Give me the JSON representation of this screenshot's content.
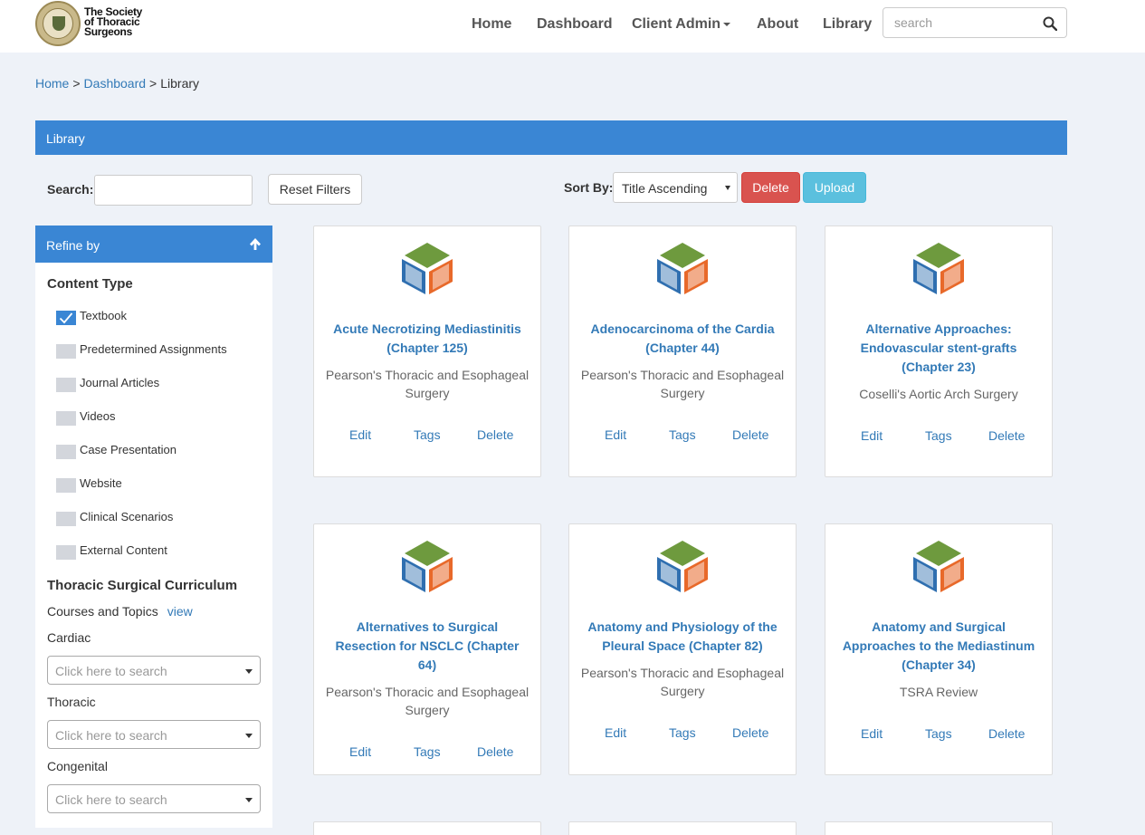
{
  "brand": {
    "name_line1": "The Society",
    "name_line2": "of Thoracic",
    "name_line3": "Surgeons"
  },
  "nav": {
    "home": "Home",
    "dashboard": "Dashboard",
    "client_admin": "Client Admin",
    "about": "About",
    "library": "Library",
    "search_placeholder": "search"
  },
  "breadcrumb": {
    "home": "Home",
    "dashboard": "Dashboard",
    "current": "Library",
    "separator": ">"
  },
  "library_bar": {
    "title": "Library"
  },
  "controls": {
    "search_label": "Search:",
    "reset_label": "Reset Filters",
    "sort_label": "Sort By:",
    "sort_value": "Title Ascending",
    "delete_label": "Delete",
    "upload_label": "Upload"
  },
  "sidebar": {
    "refine_title": "Refine by",
    "content_type_heading": "Content Type",
    "content_types": [
      {
        "label": "Textbook",
        "checked": true
      },
      {
        "label": "Predetermined Assignments",
        "checked": false
      },
      {
        "label": "Journal Articles",
        "checked": false
      },
      {
        "label": "Videos",
        "checked": false
      },
      {
        "label": "Case Presentation",
        "checked": false
      },
      {
        "label": "Website",
        "checked": false
      },
      {
        "label": "Clinical Scenarios",
        "checked": false
      },
      {
        "label": "External Content",
        "checked": false
      }
    ],
    "curriculum_heading": "Thoracic Surgical Curriculum",
    "courses_label": "Courses and Topics",
    "view_label": "view",
    "cardiac_label": "Cardiac",
    "thoracic_label": "Thoracic",
    "congenital_label": "Congenital",
    "select_placeholder": "Click here to search"
  },
  "cards": [
    {
      "title": "Acute Necrotizing Mediastinitis (Chapter 125)",
      "source": "Pearson's Thoracic and Esophageal Surgery"
    },
    {
      "title": "Adenocarcinoma of the Cardia (Chapter 44)",
      "source": "Pearson's Thoracic and Esophageal Surgery"
    },
    {
      "title": "Alternative Approaches: Endovascular stent-grafts (Chapter 23)",
      "source": "Coselli's Aortic Arch Surgery"
    },
    {
      "title": "Alternatives to Surgical Resection for NSCLC (Chapter 64)",
      "source": "Pearson's Thoracic and Esophageal Surgery"
    },
    {
      "title": "Anatomy and Physiology of the Pleural Space (Chapter 82)",
      "source": "Pearson's Thoracic and Esophageal Surgery"
    },
    {
      "title": "Anatomy and Surgical Approaches to the Mediastinum (Chapter 34)",
      "source": "TSRA Review"
    }
  ],
  "card_actions": {
    "edit": "Edit",
    "tags": "Tags",
    "delete": "Delete"
  },
  "colors": {
    "primary": "#3a86d4",
    "danger": "#d9534f",
    "info": "#5bc0de",
    "link": "#337ab7",
    "book_green": "#6e9a3e",
    "book_blue": "#2f6fb0",
    "book_orange": "#e8692a"
  }
}
